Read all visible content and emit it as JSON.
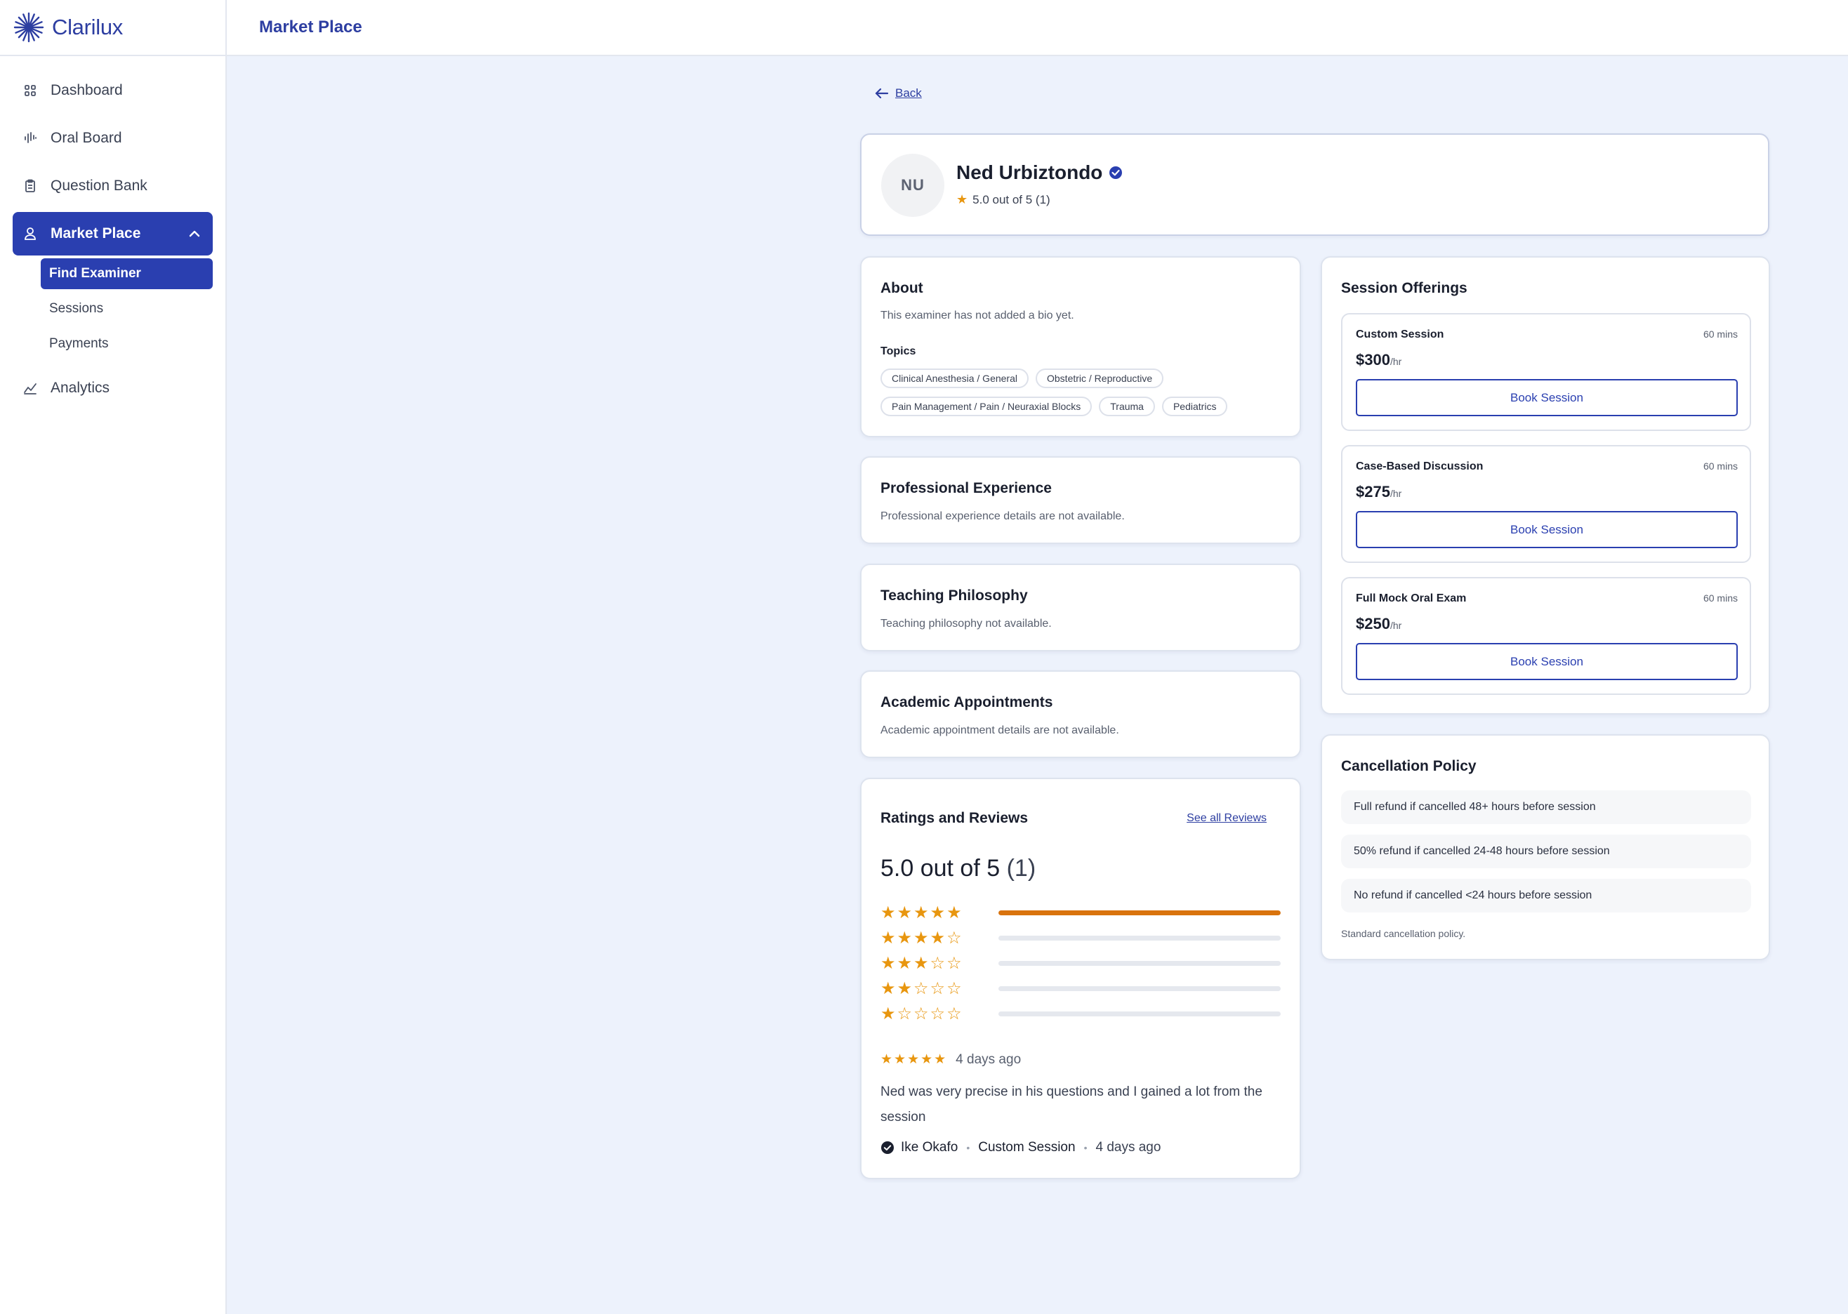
{
  "app": {
    "name": "Clarilux"
  },
  "header": {
    "title": "Market Place"
  },
  "sidebar": {
    "items": [
      {
        "label": "Dashboard",
        "icon": "grid-icon"
      },
      {
        "label": "Oral Board",
        "icon": "waveform-icon"
      },
      {
        "label": "Question Bank",
        "icon": "clipboard-icon"
      },
      {
        "label": "Market Place",
        "icon": "user-icon",
        "active": true
      },
      {
        "label": "Analytics",
        "icon": "chart-trend-icon"
      }
    ],
    "subitems": [
      {
        "label": "Find Examiner",
        "active": true
      },
      {
        "label": "Sessions"
      },
      {
        "label": "Payments"
      }
    ]
  },
  "back_label": "Back",
  "profile": {
    "initials": "NU",
    "name": "Ned Urbiztondo",
    "rating_text": "5.0 out of 5 (1)"
  },
  "about": {
    "title": "About",
    "bio": "This examiner has not added a bio yet.",
    "topics_label": "Topics",
    "topics": [
      "Clinical Anesthesia / General",
      "Obstetric / Reproductive",
      "Pain Management / Pain / Neuraxial Blocks",
      "Trauma",
      "Pediatrics"
    ]
  },
  "experience": {
    "title": "Professional Experience",
    "text": "Professional experience details are not available."
  },
  "teaching": {
    "title": "Teaching Philosophy",
    "text": "Teaching philosophy not available."
  },
  "academic": {
    "title": "Academic Appointments",
    "text": "Academic appointment details are not available."
  },
  "reviews": {
    "title": "Ratings and Reviews",
    "see_all": "See all Reviews",
    "score": "5.0 out of 5",
    "count": "(1)",
    "distribution": [
      {
        "stars": 5,
        "fraction": 1.0
      },
      {
        "stars": 4,
        "fraction": 0.0
      },
      {
        "stars": 3,
        "fraction": 0.0
      },
      {
        "stars": 2,
        "fraction": 0.0
      },
      {
        "stars": 1,
        "fraction": 0.0
      }
    ],
    "items": [
      {
        "rating": 5,
        "ago": "4 days ago",
        "text": "Ned was very precise in his questions and I gained a lot from the session",
        "author": "Ike Okafo",
        "session": "Custom Session",
        "date": "4 days ago"
      }
    ]
  },
  "offerings": {
    "title": "Session Offerings",
    "items": [
      {
        "name": "Custom Session",
        "duration": "60 mins",
        "price": "$300",
        "unit": "/hr",
        "button": "Book Session"
      },
      {
        "name": "Case-Based Discussion",
        "duration": "60 mins",
        "price": "$275",
        "unit": "/hr",
        "button": "Book Session"
      },
      {
        "name": "Full Mock Oral Exam",
        "duration": "60 mins",
        "price": "$250",
        "unit": "/hr",
        "button": "Book Session"
      }
    ]
  },
  "cancellation": {
    "title": "Cancellation Policy",
    "rules": [
      "Full refund if cancelled 48+ hours before session",
      "50% refund if cancelled 24-48 hours before session",
      "No refund if cancelled <24 hours before session"
    ],
    "note": "Standard cancellation policy."
  },
  "colors": {
    "brand": "#2a3fb0",
    "star": "#e8960f",
    "bar_fill": "#d9730d",
    "background": "#edf2fc"
  }
}
